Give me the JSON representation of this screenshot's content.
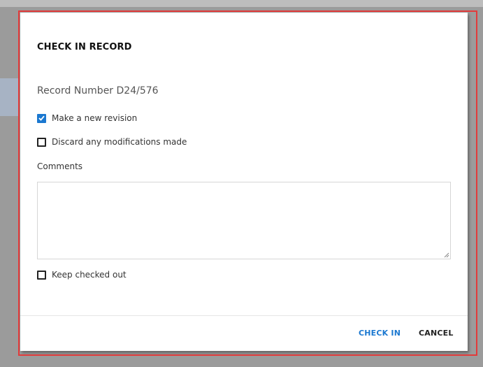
{
  "dialog": {
    "title": "CHECK IN RECORD",
    "record_number": "Record Number D24/576",
    "options": {
      "new_revision": {
        "label": "Make a new revision",
        "checked": true
      },
      "discard_modifications": {
        "label": "Discard any modifications made",
        "checked": false
      },
      "keep_checked_out": {
        "label": "Keep checked out",
        "checked": false
      }
    },
    "comments": {
      "label": "Comments",
      "value": ""
    },
    "buttons": {
      "check_in": "CHECK IN",
      "cancel": "CANCEL"
    }
  },
  "colors": {
    "accent": "#1b78d0",
    "highlight_frame": "#e23b3b",
    "backdrop": "#9b9b9b"
  },
  "icons": {
    "checkbox_checked": "checkmark-icon",
    "resize": "resize-grip-icon"
  }
}
